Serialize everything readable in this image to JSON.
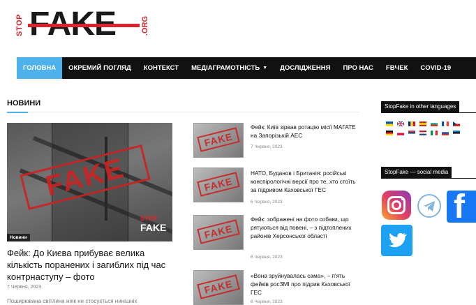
{
  "logo": {
    "stop": "STOP",
    "fake": "FAKE",
    "org": ".ORG"
  },
  "nav": {
    "items": [
      {
        "label": "ГОЛОВНА",
        "active": true
      },
      {
        "label": "ОКРЕМИЙ ПОГЛЯД"
      },
      {
        "label": "КОНТЕКСТ"
      },
      {
        "label": "МЕДІАГРАМОТНІСТЬ",
        "dropdown": true
      },
      {
        "label": "ДОСЛІДЖЕННЯ"
      },
      {
        "label": "ПРО НАС"
      },
      {
        "label": "FBЧЕК"
      },
      {
        "label": "COVID-19"
      }
    ]
  },
  "news": {
    "section_title": "НОВИНИ",
    "featured": {
      "badge": "Новини",
      "image_stamp": "FAKE",
      "image_brand_stop": "STOP",
      "image_brand_fake": "FAKE",
      "title": "Фейк: До Києва прибуває велика кількість поранених і загиблих під час контрнаступу – фото",
      "date": "7 Червня, 2023",
      "excerpt": "Поширювана світлина ніяк не стосується нинішніх"
    },
    "list": [
      {
        "title": "Фейк: Київ зірвав ротацію місії МАГАТЕ на Запорізькій АЕС",
        "date": "7 Червня, 2023",
        "stamp": "FAKE"
      },
      {
        "title": "НАТО, Буданов і Британія: російські конспірологічні версії про те, хто стоїть за підривом Каховської ГЕС",
        "date": "6 Червня, 2023",
        "stamp": "FAKE"
      },
      {
        "title": "Фейк: зображені на фото собаки, що рятуються від повені, – з підтоплених районів Херсонської області",
        "date": "6 Червня, 2023",
        "stamp": "FAKE"
      },
      {
        "title": "«Вона зруйнувалась сама», – п'ять фейків росЗМІ про підрив Каховської ГЕС",
        "date": "6 Червня, 2023",
        "stamp": "FAKE"
      }
    ]
  },
  "sidebar": {
    "languages_title": "StopFake in other languages",
    "social_title": "StopFake — social media",
    "flags": [
      {
        "icon": "flag-ukraine-icon",
        "colors": [
          "#0057b7",
          "#ffd700"
        ]
      },
      {
        "icon": "flag-uk-icon",
        "colors": [
          "#012169",
          "#c8102e"
        ]
      },
      {
        "icon": "flag-romania-icon",
        "colors": [
          "#002b7f",
          "#fcd116",
          "#ce1126"
        ]
      },
      {
        "icon": "flag-spain-icon",
        "colors": [
          "#aa151b",
          "#f1bf00",
          "#aa151b"
        ]
      },
      {
        "icon": "flag-bulgaria-icon",
        "colors": [
          "#ffffff",
          "#00966e",
          "#d62612"
        ]
      },
      {
        "icon": "flag-france-icon",
        "colors": [
          "#0055a4",
          "#ffffff",
          "#ef4135"
        ]
      },
      {
        "icon": "flag-czech-icon",
        "colors": [
          "#ffffff",
          "#d7141a",
          "#11457e"
        ]
      },
      {
        "icon": "flag-germany-icon",
        "colors": [
          "#000000",
          "#dd0000",
          "#ffce00"
        ]
      },
      {
        "icon": "flag-poland-icon",
        "colors": [
          "#ffffff",
          "#dc143c"
        ]
      },
      {
        "icon": "flag-serbia-icon",
        "colors": [
          "#c6363c",
          "#0c4076",
          "#ffffff"
        ]
      },
      {
        "icon": "flag-netherlands-icon",
        "colors": [
          "#ae1c28",
          "#ffffff",
          "#21468b"
        ]
      },
      {
        "icon": "flag-italy-icon",
        "colors": [
          "#009246",
          "#ffffff",
          "#ce2b37"
        ]
      },
      {
        "icon": "flag-russia-icon",
        "colors": [
          "#ffffff",
          "#0039a6",
          "#d52b1e"
        ]
      },
      {
        "icon": "flag-estonia-icon",
        "colors": [
          "#0072ce",
          "#000000",
          "#ffffff"
        ]
      }
    ],
    "social": [
      {
        "icon": "instagram-icon"
      },
      {
        "icon": "telegram-icon"
      },
      {
        "icon": "facebook-icon",
        "glyph": "f"
      },
      {
        "icon": "twitter-icon"
      }
    ]
  },
  "colors": {
    "accent": "#4db2ec",
    "nav_bg": "#111111",
    "logo_red": "#d8242c"
  }
}
